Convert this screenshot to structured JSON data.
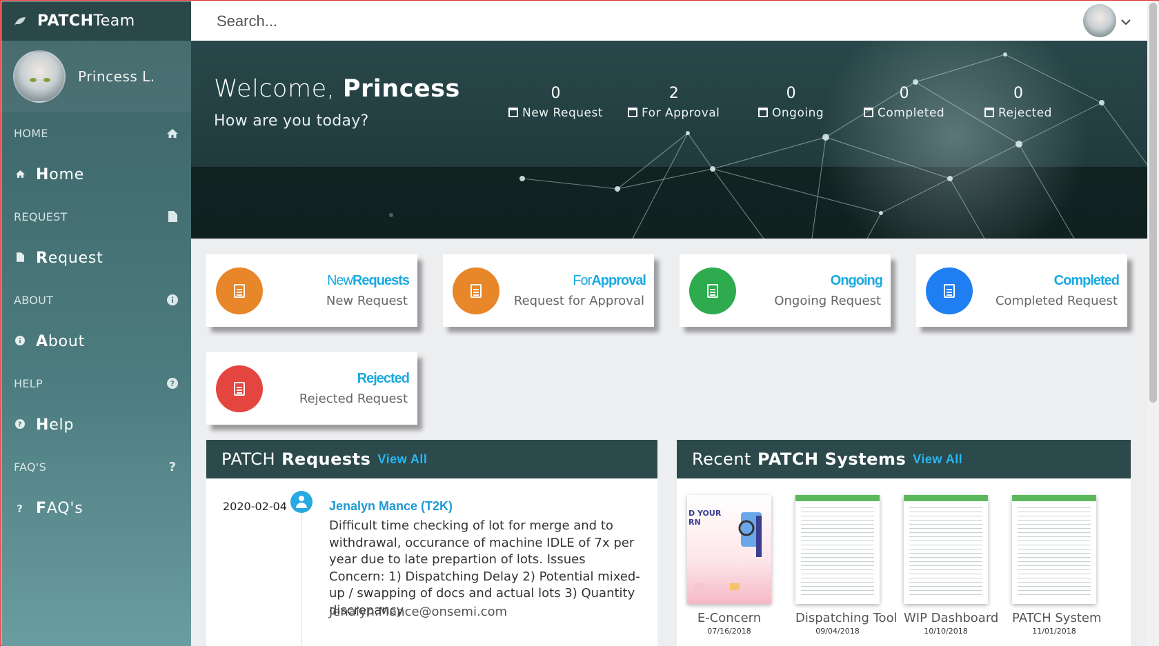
{
  "app": {
    "brand_bold": "PATCH",
    "brand_rest": "Team"
  },
  "user": {
    "name": "Princess L."
  },
  "sidebar": {
    "sections": [
      {
        "heading": "HOME",
        "heading_icon": "home-icon",
        "item": "Home",
        "item_icon": "home-icon"
      },
      {
        "heading": "REQUEST",
        "heading_icon": "file-icon",
        "item": "Request",
        "item_icon": "file-icon"
      },
      {
        "heading": "ABOUT",
        "heading_icon": "info-icon",
        "item": "About",
        "item_icon": "info-icon"
      },
      {
        "heading": "HELP",
        "heading_icon": "help-circle-icon",
        "item": "Help",
        "item_icon": "help-circle-icon"
      },
      {
        "heading": "FAQ'S",
        "heading_icon": "question-icon",
        "item": "FAQ's",
        "item_icon": "question-icon"
      }
    ]
  },
  "topbar": {
    "search_placeholder": "Search..."
  },
  "hero": {
    "greeting": "Welcome,",
    "greeting_name": "Princess",
    "subtitle": "How are you today?",
    "stats": [
      {
        "value": "0",
        "label": "New Request"
      },
      {
        "value": "2",
        "label": "For Approval"
      },
      {
        "value": "0",
        "label": "Ongoing"
      },
      {
        "value": "0",
        "label": "Completed"
      },
      {
        "value": "0",
        "label": "Rejected"
      }
    ]
  },
  "cards": [
    {
      "title_light": "New",
      "title_bold": "Requests",
      "subtitle": "New Request",
      "color": "#e8862a"
    },
    {
      "title_light": "For",
      "title_bold": "Approval",
      "subtitle": "Request for Approval",
      "color": "#e8862a"
    },
    {
      "title_light": "",
      "title_bold": "Ongoing",
      "subtitle": "Ongoing Request",
      "color": "#2eaa4f"
    },
    {
      "title_light": "",
      "title_bold": "Completed",
      "subtitle": "Completed Request",
      "color": "#1e7ef2"
    },
    {
      "title_light": "",
      "title_bold": "Rejected",
      "subtitle": "Rejected Request",
      "color": "#e5453f"
    }
  ],
  "requests_panel": {
    "title_light": "PATCH",
    "title_bold": "Requests",
    "view_all": "View All",
    "items": [
      {
        "date": "2020-02-04",
        "name": "Jenalyn Mance (T2K)",
        "description": "Difficult time checking of lot for merge and to withdrawal, occurance of machine IDLE of 7x per year due to late prepartion of lots. Issues Concern: 1) Dispatching Delay 2) Potential mixed-up / swapping of docs and actual lots 3) Quantity discrepancy",
        "email": "Jenalyn.Mance@onsemi.com"
      }
    ]
  },
  "systems_panel": {
    "title_light": "Recent",
    "title_bold": "PATCH Systems",
    "view_all": "View All",
    "items": [
      {
        "name": "E-Concern",
        "date": "07/16/2018"
      },
      {
        "name": "Dispatching Tool",
        "date": "09/04/2018"
      },
      {
        "name": "WIP Dashboard",
        "date": "10/10/2018"
      },
      {
        "name": "PATCH System",
        "date": "11/01/2018"
      }
    ]
  }
}
